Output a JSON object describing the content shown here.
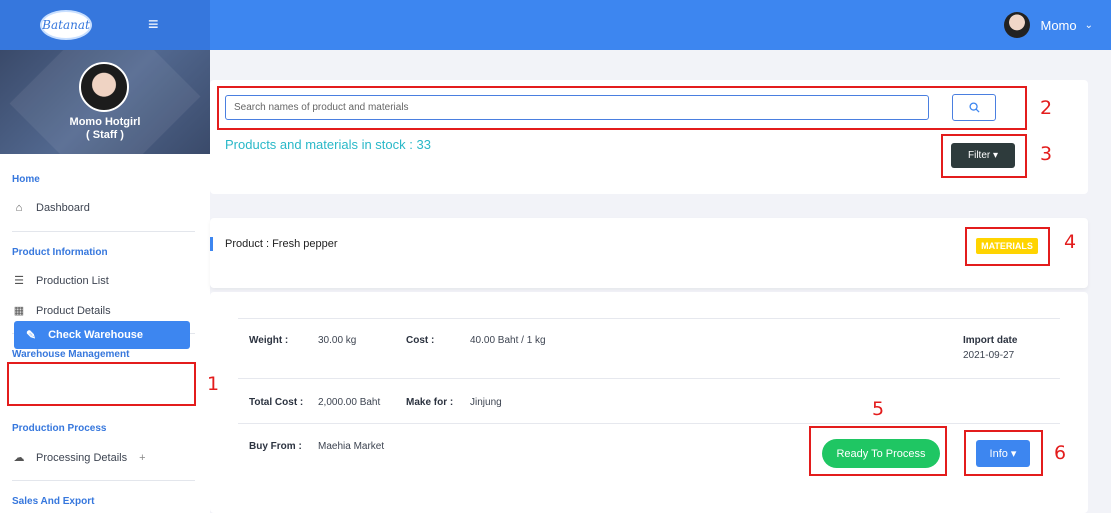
{
  "topbar": {
    "logo_text": "Batanat",
    "menu_icon": "hamburger-icon",
    "user_name": "Momo",
    "chevron_icon": "chevron-down-icon"
  },
  "sidebar": {
    "profile_name": "Momo Hotgirl",
    "profile_role": "( Staff )",
    "sections": {
      "home": "Home",
      "product_information": "Product Information",
      "warehouse_management": "Warehouse Management",
      "production_process": "Production Process",
      "sales_and_export": "Sales And Export"
    },
    "items": {
      "dashboard": "Dashboard",
      "production_list": "Production List",
      "product_details": "Product Details",
      "check_warehouse": "Check Warehouse",
      "processing_details": "Processing Details"
    },
    "expand_symbol": "+"
  },
  "search": {
    "placeholder": "Search names of product and materials",
    "icon": "search-icon"
  },
  "stock": {
    "title": "Products and materials in stock : 33"
  },
  "filter": {
    "label": "Filter ▾"
  },
  "product": {
    "title": "Product : Fresh pepper",
    "badge": "MATERIALS",
    "weight_label": "Weight :",
    "weight_value": "30.00 kg",
    "cost_label": "Cost :",
    "cost_value": "40.00 Baht / 1 kg",
    "import_label": "Import date",
    "import_value": "2021-09-27",
    "total_cost_label": "Total Cost :",
    "total_cost_value": "2,000.00 Baht",
    "make_for_label": "Make for :",
    "make_for_value": "Jinjung",
    "buy_from_label": "Buy From :",
    "buy_from_value": "Maehia Market",
    "ready_button": "Ready To Process",
    "info_button": "Info ▾"
  },
  "annotations": [
    "1",
    "2",
    "3",
    "4",
    "5",
    "6"
  ],
  "colors": {
    "primary": "#3d86f0",
    "accent_teal": "#29b8c8",
    "success": "#1fc663",
    "badge": "#ffd400",
    "annotation": "#e31c1c"
  }
}
